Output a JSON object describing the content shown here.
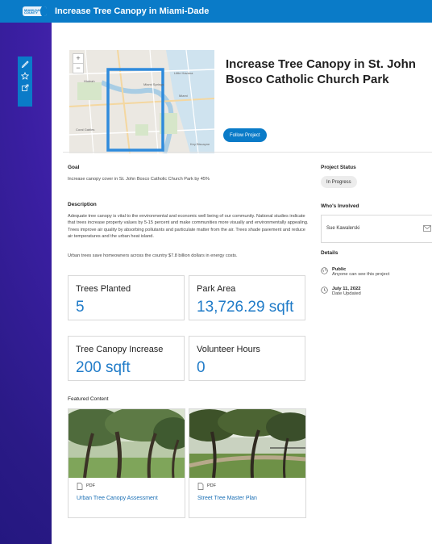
{
  "app": {
    "title": "Increase Tree Canopy in Miami-Dade",
    "logo_text": "MIAMI-DADE COUNTY"
  },
  "sidebar_tools": [
    {
      "name": "pencil-icon"
    },
    {
      "name": "star-icon"
    },
    {
      "name": "share-icon"
    }
  ],
  "project": {
    "title": "Increase Tree Canopy in St. John Bosco Catholic Church Park",
    "follow_label": "Follow Project"
  },
  "map": {
    "zoom_in": "+",
    "zoom_out": "−",
    "labels": [
      "Hialeah",
      "Miami Springs",
      "Coral Gables",
      "Miami",
      "Little Havana",
      "Key Biscayne"
    ]
  },
  "goal": {
    "heading": "Goal",
    "text": "Increase canopy cover in St. John Bosco Catholic Church Park by 45%"
  },
  "description": {
    "heading": "Description",
    "para1": "Adequate tree canopy is vital to the environmental and economic well being of our community. National studies indicate that trees increase property values by 5-15 percent and make communities more visually and environmentally appealing. Trees improve air quality by absorbing pollutants and particulate matter from the air. Trees shade pavement and reduce air temperatures and the urban heat island.",
    "para2": "Urban trees save homeowners across the country $7.8 billion dollars in energy costs."
  },
  "stats": [
    {
      "label": "Trees Planted",
      "value": "5"
    },
    {
      "label": "Park Area",
      "value": "13,726.29 sqft"
    },
    {
      "label": "Tree Canopy Increase",
      "value": "200 sqft"
    },
    {
      "label": "Volunteer Hours",
      "value": "0"
    }
  ],
  "featured": {
    "heading": "Featured Content",
    "items": [
      {
        "type": "PDF",
        "title": "Urban Tree Canopy Assessment"
      },
      {
        "type": "PDF",
        "title": "Street Tree Master Plan"
      }
    ]
  },
  "status": {
    "heading": "Project Status",
    "value": "In Progress"
  },
  "involved": {
    "heading": "Who's Involved",
    "name": "Sue Kawalerski"
  },
  "details": {
    "heading": "Details",
    "visibility_title": "Public",
    "visibility_desc": "Anyone can see this project",
    "date_title": "July 11, 2022",
    "date_desc": "Date Updated"
  },
  "colors": {
    "accent": "#0a7bc8",
    "value_blue": "#1f7bc8",
    "background": "#3b1fa3"
  }
}
